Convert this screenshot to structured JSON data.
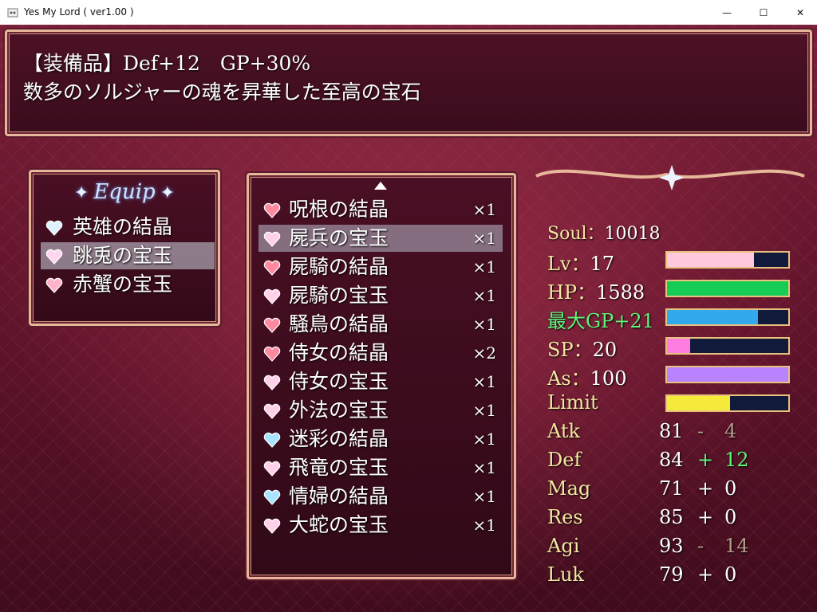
{
  "window": {
    "title": "Yes My Lord ( ver1.00 )",
    "minimize_glyph": "—",
    "maximize_glyph": "☐",
    "close_glyph": "✕"
  },
  "help": {
    "line1": "【装備品】Def+12　GP+30%",
    "line2": "数多のソルジャーの魂を昇華した至高の宝石"
  },
  "equip": {
    "title": "Equip",
    "sparkle": "✦",
    "items": [
      {
        "label": "英雄の結晶",
        "color": "#dff3ff"
      },
      {
        "label": "跳兎の宝玉",
        "color": "#ffd6ef"
      },
      {
        "label": "赤蟹の宝玉",
        "color": "#ffb3c8"
      }
    ],
    "selected_index": 1
  },
  "list": {
    "scroll_indicator": "▲",
    "items": [
      {
        "label": "呪根の結晶",
        "qty": "×1",
        "color": "#ff8aa0"
      },
      {
        "label": "屍兵の宝玉",
        "qty": "×1",
        "color": "#ffd0ea"
      },
      {
        "label": "屍騎の結晶",
        "qty": "×1",
        "color": "#ff8aa0"
      },
      {
        "label": "屍騎の宝玉",
        "qty": "×1",
        "color": "#ffd0ea"
      },
      {
        "label": "騒鳥の結晶",
        "qty": "×1",
        "color": "#ff8aa0"
      },
      {
        "label": "侍女の結晶",
        "qty": "×2",
        "color": "#ff8aa0"
      },
      {
        "label": "侍女の宝玉",
        "qty": "×1",
        "color": "#ffd0ea"
      },
      {
        "label": "外法の宝玉",
        "qty": "×1",
        "color": "#ffd0ea"
      },
      {
        "label": "迷彩の結晶",
        "qty": "×1",
        "color": "#a8e4ff"
      },
      {
        "label": "飛竜の宝玉",
        "qty": "×1",
        "color": "#ffd0ea"
      },
      {
        "label": "情婦の結晶",
        "qty": "×1",
        "color": "#a8e4ff"
      },
      {
        "label": "大蛇の宝玉",
        "qty": "×1",
        "color": "#ffd0ea"
      }
    ],
    "selected_index": 1
  },
  "status": {
    "soul_label": "Soul：",
    "soul_value": "10018",
    "gauges": [
      {
        "label": "Lv：",
        "value": "17",
        "fill": 0.72,
        "color": "#ffc8dc",
        "label_green": false
      },
      {
        "label": "HP：",
        "value": "1588",
        "fill": 1.0,
        "color": "#17cc55",
        "label_green": false
      },
      {
        "label": "最大GP+21",
        "value": "",
        "fill": 0.75,
        "color": "#33a8ea",
        "label_green": true
      },
      {
        "label": "SP：",
        "value": "20",
        "fill": 0.19,
        "color": "#ff7de0",
        "label_green": false
      },
      {
        "label": "As：",
        "value": "100",
        "fill": 1.0,
        "color": "#b982ff",
        "label_green": false
      },
      {
        "label": "Limit",
        "value": "",
        "fill": 0.52,
        "color": "#f5ea3c",
        "label_green": false
      }
    ],
    "params": [
      {
        "name": "Atk",
        "base": "81",
        "sign": "-",
        "mod": "4",
        "color": "#b89a8a"
      },
      {
        "name": "Def",
        "base": "84",
        "sign": "+",
        "mod": "12",
        "color": "#5ef57a"
      },
      {
        "name": "Mag",
        "base": "71",
        "sign": "+",
        "mod": "0",
        "color": "#ffffff"
      },
      {
        "name": "Res",
        "base": "85",
        "sign": "+",
        "mod": "0",
        "color": "#ffffff"
      },
      {
        "name": "Agi",
        "base": "93",
        "sign": "-",
        "mod": "14",
        "color": "#b89a8a"
      },
      {
        "name": "Luk",
        "base": "79",
        "sign": "+",
        "mod": "0",
        "color": "#ffffff"
      }
    ]
  }
}
